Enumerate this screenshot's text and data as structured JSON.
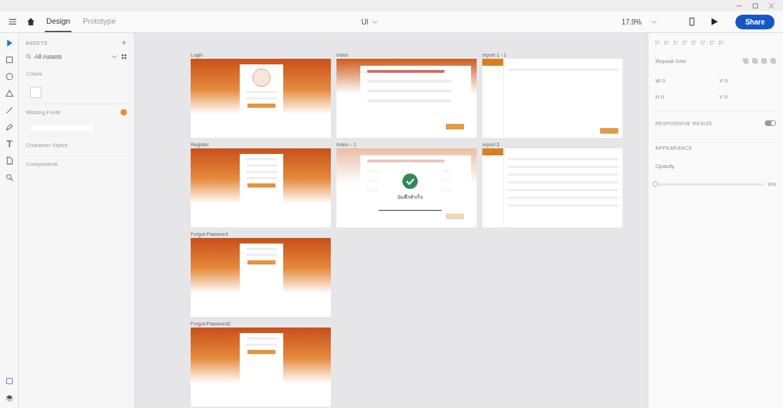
{
  "window": {
    "title": "UI"
  },
  "toolbar": {
    "tabs": [
      {
        "label": "Design",
        "selected": true
      },
      {
        "label": "Prototype",
        "selected": false
      }
    ],
    "zoom": "17.9%",
    "share": "Share"
  },
  "tools": [
    {
      "kind": "select",
      "selected": true
    },
    {
      "kind": "rectangle",
      "selected": false
    },
    {
      "kind": "ellipse",
      "selected": false
    },
    {
      "kind": "triangle",
      "selected": false
    },
    {
      "kind": "line",
      "selected": false
    },
    {
      "kind": "pen",
      "selected": false
    },
    {
      "kind": "text",
      "selected": false
    },
    {
      "kind": "artboard",
      "selected": false
    },
    {
      "kind": "zoom",
      "selected": false
    }
  ],
  "assets": {
    "heading": "ASSETS",
    "filter": "All Assets",
    "sections": [
      {
        "label": "Colors",
        "warning": false
      },
      {
        "label": "Missing Fonts",
        "warning": true
      },
      {
        "label": "Character Styles",
        "warning": false
      },
      {
        "label": "Components",
        "warning": false
      }
    ]
  },
  "artboard_columns": [
    [
      {
        "label": "Login",
        "kind": "login"
      },
      {
        "label": "Register",
        "kind": "register"
      },
      {
        "label": "Forgot-Password",
        "kind": "forgot"
      },
      {
        "label": "Forgot-Password2",
        "kind": "forgot"
      }
    ],
    [
      {
        "label": "Index",
        "kind": "form"
      },
      {
        "label": "index – 1",
        "kind": "success",
        "message": "บันทึกสำเร็จ"
      }
    ],
    [
      {
        "label": "report 1 - 1",
        "kind": "report"
      },
      {
        "label": "report-3",
        "kind": "table"
      }
    ]
  ],
  "properties": {
    "repeat_grid": "Repeat Grid",
    "fields": [
      "W 0",
      "X 0",
      "H 0",
      "Y 0"
    ],
    "responsive_resize": {
      "label": "RESPONSIVE RESIZE",
      "on": true
    },
    "appearance": "APPEARANCE",
    "opacity": {
      "label": "Opacity",
      "value": "0%",
      "level": 0
    }
  }
}
